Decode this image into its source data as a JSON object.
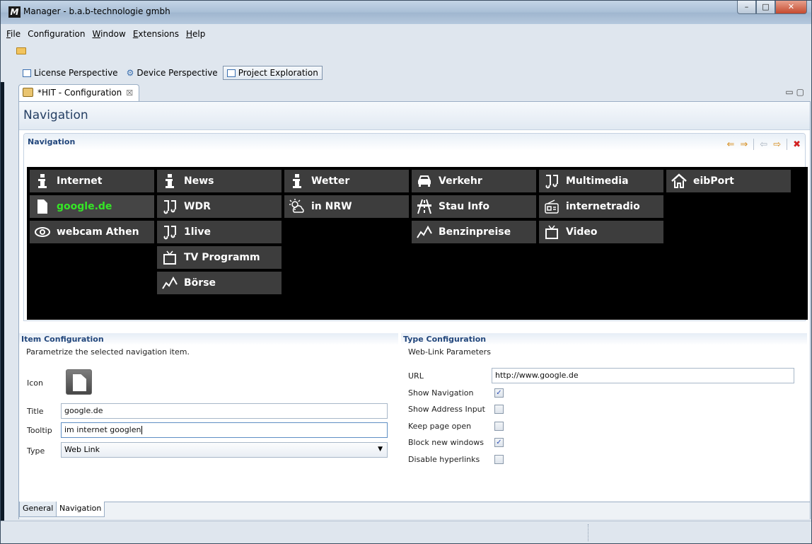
{
  "window": {
    "title": "Manager - b.a.b-technologie gmbh",
    "app_icon": "M",
    "min": "–",
    "max": "□",
    "close": "✕"
  },
  "menu": [
    {
      "pre": "",
      "acc": "F",
      "post": "ile"
    },
    {
      "pre": "Configuration",
      "acc": "",
      "post": ""
    },
    {
      "pre": "",
      "acc": "W",
      "post": "indow"
    },
    {
      "pre": "",
      "acc": "E",
      "post": "xtensions"
    },
    {
      "pre": "",
      "acc": "H",
      "post": "elp"
    }
  ],
  "perspectives": [
    {
      "label": "License Perspective",
      "icon": "license-perspective-icon"
    },
    {
      "label": "Device Perspective",
      "icon": "device-perspective-icon"
    },
    {
      "label": "Project Exploration",
      "icon": "project-exploration-icon"
    }
  ],
  "editor_tab": {
    "label": "*HIT - Configuration",
    "close": "☒"
  },
  "form": {
    "title": "Navigation"
  },
  "nav_section": {
    "title": "Navigation"
  },
  "tiles": [
    {
      "label": "Internet",
      "icon": "info-icon",
      "selected": false
    },
    {
      "label": "google.de",
      "icon": "document-icon",
      "selected": true
    },
    {
      "label": "webcam Athen",
      "icon": "eye-icon",
      "selected": false
    },
    {
      "label": "News",
      "icon": "info-icon",
      "selected": false
    },
    {
      "label": "WDR",
      "icon": "music-icon",
      "selected": false
    },
    {
      "label": "1live",
      "icon": "music-icon",
      "selected": false
    },
    {
      "label": "TV Programm",
      "icon": "tv-icon",
      "selected": false
    },
    {
      "label": "Börse",
      "icon": "chart-icon",
      "selected": false
    },
    {
      "label": "Wetter",
      "icon": "info-icon",
      "selected": false
    },
    {
      "label": "in NRW",
      "icon": "weather-icon",
      "selected": false
    },
    {
      "label": "Verkehr",
      "icon": "car-icon",
      "selected": false
    },
    {
      "label": "Stau Info",
      "icon": "road-icon",
      "selected": false
    },
    {
      "label": "Benzinpreise",
      "icon": "chart-icon",
      "selected": false
    },
    {
      "label": "Multimedia",
      "icon": "music-icon",
      "selected": false
    },
    {
      "label": "internetradio",
      "icon": "radio-icon",
      "selected": false
    },
    {
      "label": "Video",
      "icon": "tv-icon",
      "selected": false
    },
    {
      "label": "eibPort",
      "icon": "home-icon",
      "selected": false
    }
  ],
  "item_config": {
    "title": "Item Configuration",
    "desc": "Parametrize the selected navigation item.",
    "icon_label": "Icon",
    "title_label": "Title",
    "title_value": "google.de",
    "tooltip_label": "Tooltip",
    "tooltip_value": "im internet googlen",
    "type_label": "Type",
    "type_value": "Web Link"
  },
  "type_config": {
    "title": "Type Configuration",
    "desc": "Web-Link Parameters",
    "url_label": "URL",
    "url_value": "http://www.google.de",
    "options": [
      {
        "label": "Show Navigation",
        "checked": true
      },
      {
        "label": "Show Address Input",
        "checked": false
      },
      {
        "label": "Keep page open",
        "checked": false
      },
      {
        "label": "Block new windows",
        "checked": true
      },
      {
        "label": "Disable hyperlinks",
        "checked": false
      }
    ]
  },
  "bottom_tabs": [
    {
      "label": "General"
    },
    {
      "label": "Navigation"
    }
  ],
  "check_glyph": "✓",
  "colors": {
    "selected_tile_text": "#35e626",
    "tile_bg": "#3d3d3d",
    "canvas_bg": "#000000"
  }
}
